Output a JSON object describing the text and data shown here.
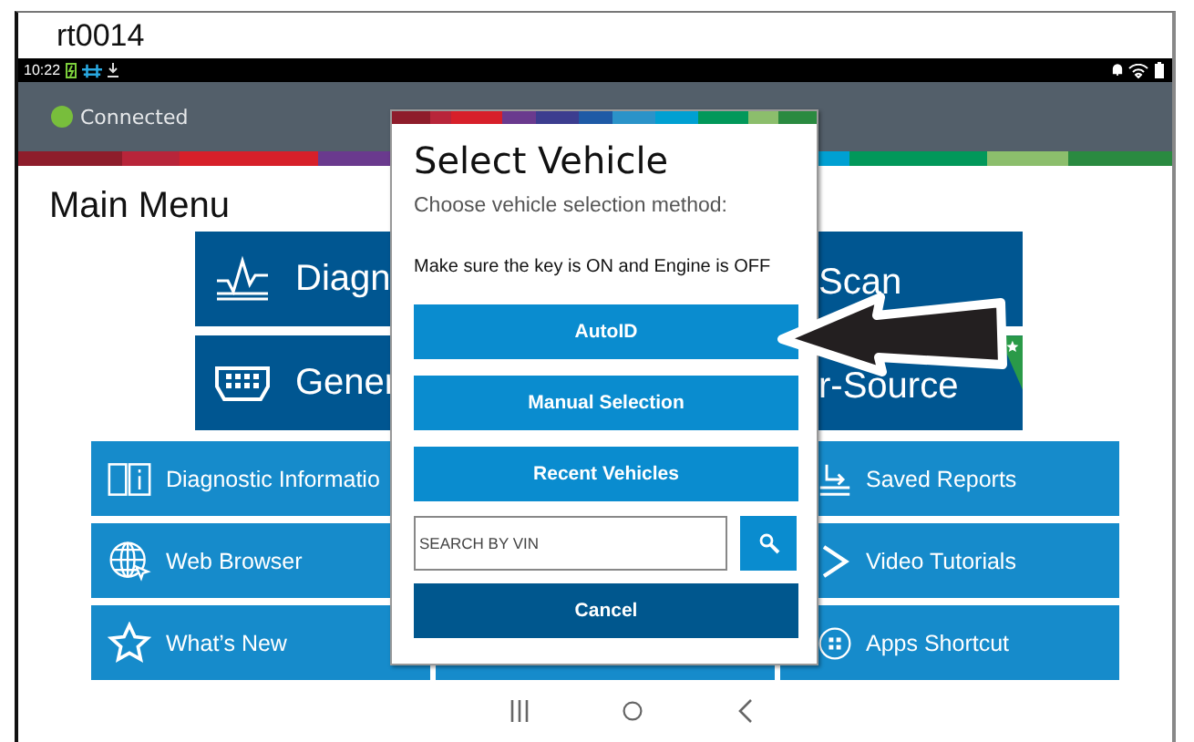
{
  "caption": "rt0014",
  "status_bar": {
    "time": "10:22"
  },
  "header": {
    "connection": "Connected"
  },
  "main_menu": {
    "title": "Main Menu",
    "large_tiles": [
      {
        "label_left": "Diagn",
        "label_right": "Scan",
        "badge": false
      },
      {
        "label_left": "Gener",
        "label_right": "r-Source",
        "badge": true
      }
    ],
    "left_tiles": [
      {
        "label": "Diagnostic Informatio"
      },
      {
        "label": "Web Browser"
      },
      {
        "label": "What’s New"
      }
    ],
    "right_tiles": [
      {
        "label": "Saved Reports"
      },
      {
        "label": "Video Tutorials"
      },
      {
        "label": "Apps Shortcut"
      }
    ]
  },
  "dialog": {
    "title": "Select Vehicle",
    "subtitle": "Choose vehicle selection method:",
    "notice": "Make sure the key is ON and Engine is OFF",
    "buttons": [
      "AutoID",
      "Manual Selection",
      "Recent Vehicles"
    ],
    "search": {
      "placeholder": "SEARCH BY VIN"
    },
    "cancel": "Cancel"
  }
}
